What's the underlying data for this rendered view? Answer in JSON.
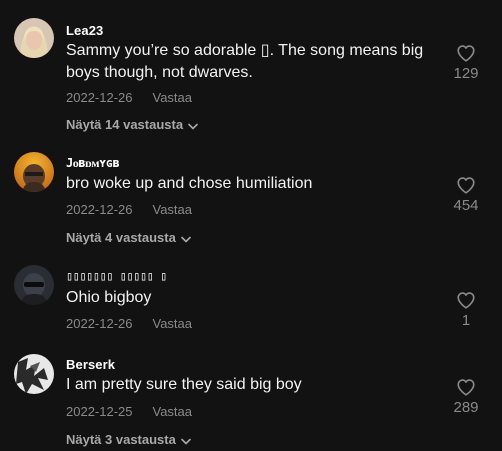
{
  "comments": [
    {
      "username": "Lea23",
      "lines": [
        "Sammy you’re so adorable ▯. The song means big",
        "boys though, not dwarves."
      ],
      "date": "2022-12-26",
      "reply_label": "Vastaa",
      "likes": "129",
      "replies_label": "Näytä 14 vastausta"
    },
    {
      "username": "Jᴏʙᴅᴍʏɢʙ",
      "lines": [
        "bro woke up and chose humiliation"
      ],
      "date": "2022-12-26",
      "reply_label": "Vastaa",
      "likes": "454",
      "replies_label": "Näytä 4 vastausta"
    },
    {
      "username": "▯▯▯▯▯▯▯ ▯▯▯▯▯ ▯",
      "lines": [
        "Ohio bigboy"
      ],
      "date": "2022-12-26",
      "reply_label": "Vastaa",
      "likes": "1"
    },
    {
      "username": "Berserk",
      "lines": [
        "I am pretty sure they said big boy"
      ],
      "date": "2022-12-25",
      "reply_label": "Vastaa",
      "likes": "289",
      "replies_label": "Näytä 3 vastausta"
    }
  ],
  "icons": {
    "like": "heart-outline-icon",
    "expand": "chevron-down-icon"
  },
  "colors": {
    "background": "#121212",
    "text_primary": "#ffffff",
    "text_secondary": "#8a8a8a"
  }
}
